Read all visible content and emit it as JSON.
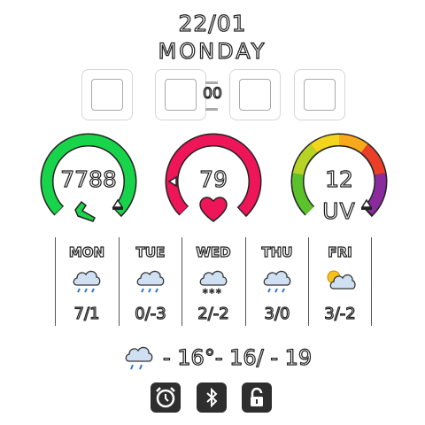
{
  "date": "22/01",
  "weekday": "MONDAY",
  "time_tiles": {
    "center_number": "00"
  },
  "gauges": {
    "steps": {
      "value": "7788",
      "icon": "footprint-icon",
      "color": "#18d44a"
    },
    "heart_rate": {
      "value": "79",
      "icon": "heart-icon",
      "color": "#ee1558"
    },
    "uv": {
      "value": "12",
      "label": "UV",
      "icon": "uv-gradient-icon"
    }
  },
  "forecast": [
    {
      "day": "MON",
      "temp": "7/1",
      "icon": "rain-cloud-icon"
    },
    {
      "day": "TUE",
      "temp": "0/-3",
      "icon": "rain-cloud-icon"
    },
    {
      "day": "WED",
      "temp": "2/-2",
      "icon": "snow-cloud-icon"
    },
    {
      "day": "THU",
      "temp": "3/0",
      "icon": "rain-cloud-icon"
    },
    {
      "day": "FRI",
      "temp": "3/-2",
      "icon": "partly-cloudy-icon"
    }
  ],
  "current": {
    "icon": "rain-cloud-icon",
    "temp_text": "- 16°- 16/ - 19"
  },
  "status_icons": [
    "alarm-icon",
    "bluetooth-icon",
    "lock-icon"
  ]
}
